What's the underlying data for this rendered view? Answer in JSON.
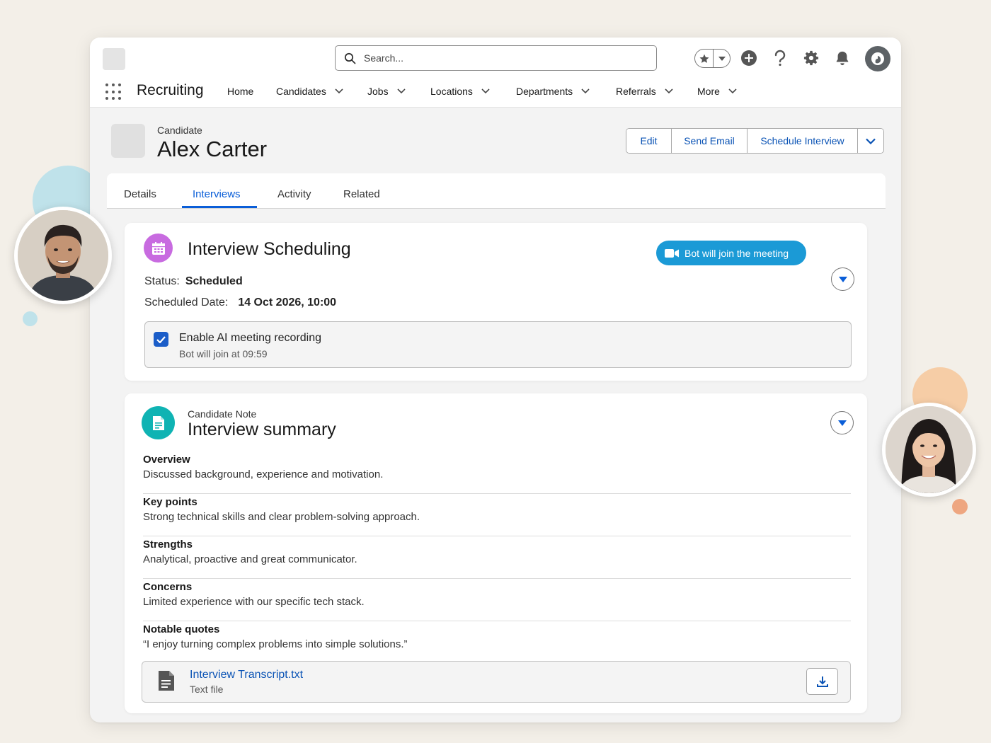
{
  "search": {
    "placeholder": "Search..."
  },
  "nav": {
    "app_name": "Recruiting",
    "items": [
      {
        "label": "Home"
      },
      {
        "label": "Candidates"
      },
      {
        "label": "Jobs"
      },
      {
        "label": "Locations"
      },
      {
        "label": "Departments"
      },
      {
        "label": "Referrals"
      },
      {
        "label": "More"
      }
    ]
  },
  "header_icons": [
    "favorites-star-icon",
    "plus-circle-icon",
    "help-icon",
    "gear-icon",
    "bell-icon",
    "user-avatar"
  ],
  "record": {
    "type": "Candidate",
    "name": "Alex Carter",
    "actions": [
      "Edit",
      "Send Email",
      "Schedule Interview"
    ]
  },
  "tabs": [
    {
      "label": "Details"
    },
    {
      "label": "Interviews"
    },
    {
      "label": "Activity"
    },
    {
      "label": "Related"
    }
  ],
  "active_tab": "Interviews",
  "scheduling": {
    "title": "Interview Scheduling",
    "bot_pill": "Bot will join the meeting",
    "status_label": "Status:",
    "status_value": "Scheduled",
    "date_label": "Scheduled Date:",
    "date_value": "14 Oct 2026, 10:00",
    "ai_recording_label": "Enable AI meeting recording",
    "ai_recording_sub": "Bot will join at 09:59",
    "ai_recording_checked": true
  },
  "note": {
    "type": "Candidate Note",
    "title": "Interview summary",
    "sections": [
      {
        "heading": "Overview",
        "body": "Discussed background, experience and motivation."
      },
      {
        "heading": "Key points",
        "body": "Strong technical skills and clear problem-solving approach."
      },
      {
        "heading": "Strengths",
        "body": "Analytical, proactive and great communicator."
      },
      {
        "heading": "Concerns",
        "body": "Limited experience with our specific tech stack."
      },
      {
        "heading": "Notable quotes",
        "body": "“I enjoy turning complex problems into simple solutions.”"
      }
    ],
    "attachment": {
      "name": "Interview Transcript.txt",
      "type": "Text file"
    }
  },
  "colors": {
    "accent_blue": "#0a5ed8",
    "link_blue": "#0a53b5",
    "calendar_icon": "#c86be0",
    "note_icon": "#0fb3b3",
    "bot_pill": "#1b9ad6",
    "background": "#f3efe8"
  }
}
